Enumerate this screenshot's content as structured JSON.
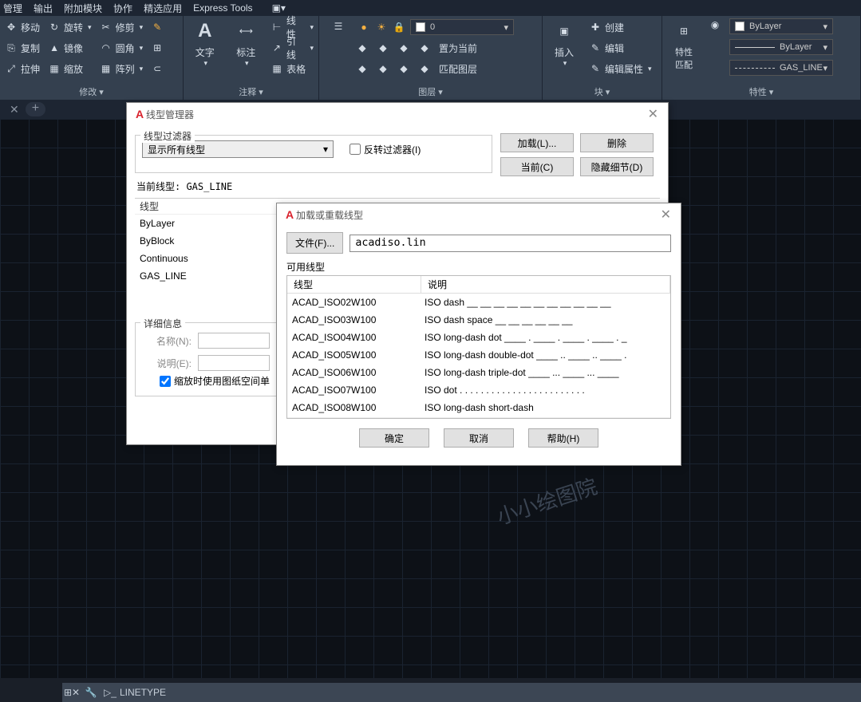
{
  "menubar": [
    "管理",
    "输出",
    "附加模块",
    "协作",
    "精选应用",
    "Express Tools"
  ],
  "ribbon": {
    "modify": {
      "title": "修改 ▾",
      "c1": [
        "移动",
        "复制",
        "拉伸"
      ],
      "c2": [
        "旋转",
        "镜像",
        "缩放"
      ],
      "c3": [
        "修剪",
        "圆角",
        "阵列"
      ]
    },
    "annot": {
      "title": "注释 ▾",
      "text": "文字",
      "dim": "标注",
      "line": "线性",
      "leader": "引线",
      "table": "表格"
    },
    "layer": {
      "title": "图层 ▾",
      "props": "图层\n特性",
      "current": "置为当前",
      "match": "匹配图层",
      "combo": "0"
    },
    "block": {
      "title": "块 ▾",
      "insert": "插入",
      "create": "创建",
      "edit": "编辑",
      "attr": "编辑属性"
    },
    "props": {
      "title": "特性 ▾",
      "match": "特性\n匹配",
      "bylayer": "ByLayer",
      "bylayer2": "ByLayer",
      "gasline": "GAS_LINE"
    }
  },
  "dlg1": {
    "title": "线型管理器",
    "filter_group": "线型过滤器",
    "filter_sel": "显示所有线型",
    "invert": "反转过滤器(I)",
    "btn_load": "加载(L)...",
    "btn_delete": "删除",
    "btn_current": "当前(C)",
    "btn_hide": "隐藏细节(D)",
    "current": "当前线型:  GAS_LINE",
    "hdr": "线型",
    "rows": [
      "ByLayer",
      "ByBlock",
      "Continuous",
      "GAS_LINE"
    ],
    "detail_title": "详细信息",
    "name_lbl": "名称(N):",
    "desc_lbl": "说明(E):",
    "zoom_chk": "缩放时使用图纸空间单"
  },
  "dlg2": {
    "title": "加载或重载线型",
    "file_btn": "文件(F)...",
    "file_val": "acadiso.lin",
    "avail": "可用线型",
    "hdr1": "线型",
    "hdr2": "说明",
    "rows": [
      {
        "n": "ACAD_ISO02W100",
        "d": "ISO dash __ __ __ __ __ __ __ __ __ __ __"
      },
      {
        "n": "ACAD_ISO03W100",
        "d": "ISO dash space __   __   __   __   __   __"
      },
      {
        "n": "ACAD_ISO04W100",
        "d": "ISO long-dash dot ____ . ____ . ____ . ____ . _"
      },
      {
        "n": "ACAD_ISO05W100",
        "d": "ISO long-dash double-dot ____ .. ____ .. ____ ."
      },
      {
        "n": "ACAD_ISO06W100",
        "d": "ISO long-dash triple-dot ____ ... ____ ... ____"
      },
      {
        "n": "ACAD_ISO07W100",
        "d": "ISO dot . . . . . . . . . . . . . . . . . . . . . . . ."
      },
      {
        "n": "ACAD_ISO08W100",
        "d": "ISO long-dash short-dash"
      }
    ],
    "ok": "确定",
    "cancel": "取消",
    "help": "帮助(H)"
  },
  "cmd": {
    "prompt": "LINETYPE"
  },
  "wm": "小小绘图院"
}
